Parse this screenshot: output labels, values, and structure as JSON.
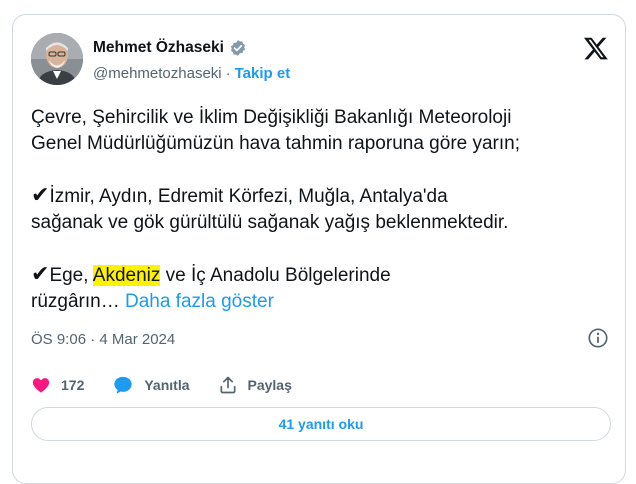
{
  "author": {
    "name": "Mehmet Özhaseki",
    "handle": "@mehmetozhaseki",
    "separator": "·",
    "follow_label": "Takip et"
  },
  "tweet": {
    "line1": "Çevre, Şehircilik ve İklim Değişikliği Bakanlığı Meteoroloji",
    "line2": "Genel Müdürlüğümüzün hava tahmin raporuna göre yarın;",
    "check": "✔",
    "p2_line1": "İzmir, Aydın, Edremit Körfezi, Muğla, Antalya'da",
    "p2_line2": "sağanak ve gök gürültülü sağanak yağış beklenmektedir.",
    "p3_pre": "Ege, ",
    "p3_highlight": "Akdeniz",
    "p3_post": " ve İç Anadolu Bölgelerinde",
    "p3_line2": "rüzgârın… ",
    "show_more": "Daha fazla göster"
  },
  "meta": {
    "timestamp": "ÖS 9:06 · 4 Mar 2024"
  },
  "actions": {
    "likes_count": "172",
    "reply_label": "Yanıtla",
    "share_label": "Paylaş"
  },
  "replies_button": "41 yanıtı oku",
  "colors": {
    "accent": "#1d9bf0",
    "like": "#f91880",
    "text": "#0f1419",
    "muted": "#536471",
    "highlight": "#fff200"
  }
}
